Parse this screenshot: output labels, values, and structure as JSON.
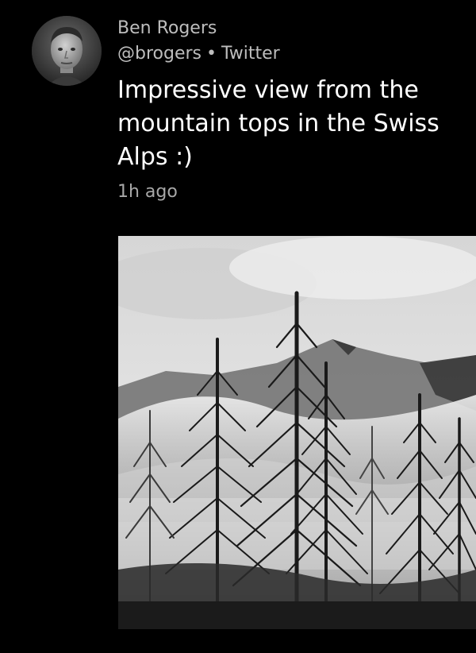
{
  "post": {
    "author": {
      "name": "Ben Rogers",
      "handle": "@brogers",
      "separator": "•",
      "source": "Twitter",
      "avatar_icon": "user-avatar-photo"
    },
    "text": "Impressive view from the mountain tops in the Swiss Alps :)",
    "timestamp": "1h ago",
    "image": {
      "icon": "photo-misty-pine-forest"
    }
  },
  "colors": {
    "background": "#000000",
    "primary_text": "#ffffff",
    "secondary_text": "#bdbdbd"
  }
}
